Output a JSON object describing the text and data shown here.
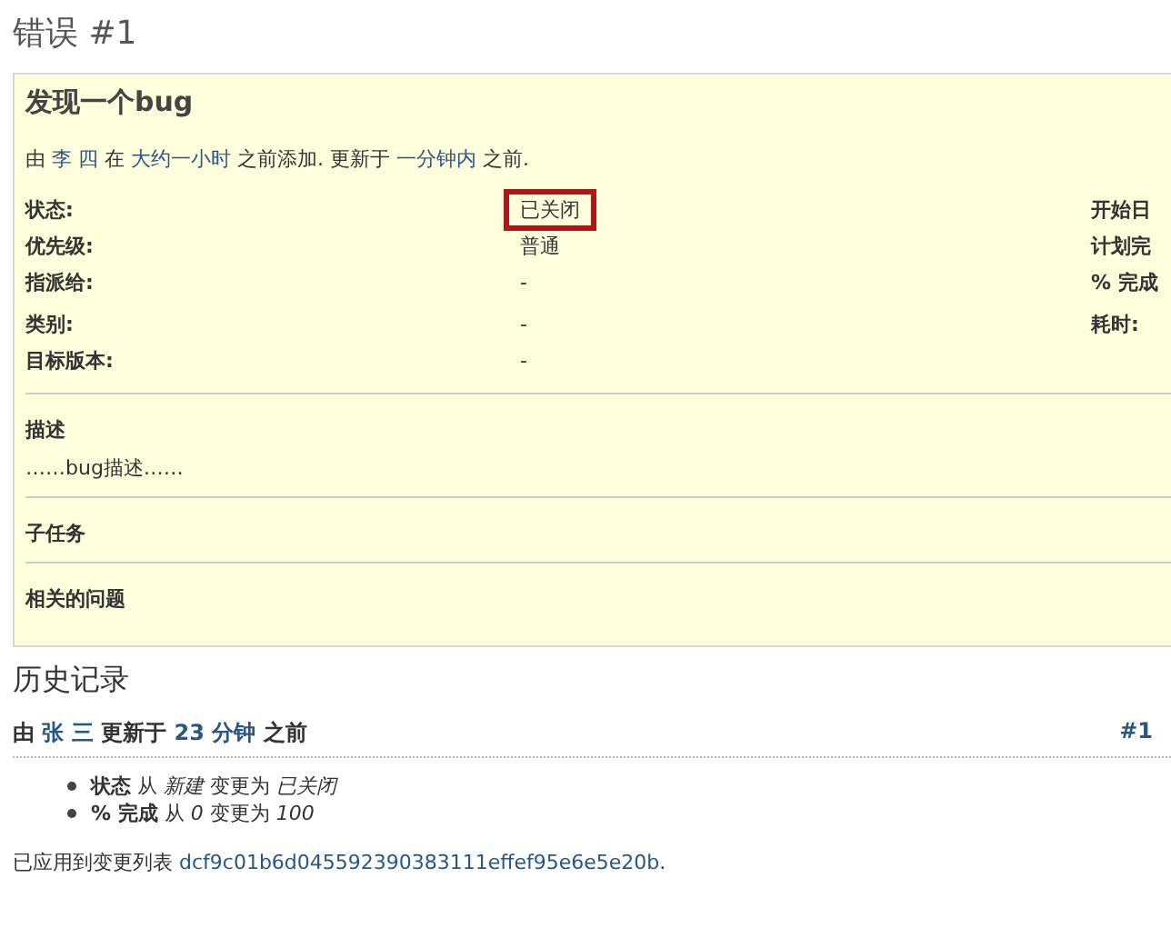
{
  "page_title": "错误 #1",
  "issue": {
    "subject": "发现一个bug",
    "meta": {
      "by": "由 ",
      "author": "李 四",
      "at": " 在 ",
      "age": "大约一小时",
      "added": " 之前添加. 更新于 ",
      "updated": "一分钟内",
      "end": " 之前."
    },
    "attributes": [
      {
        "label": "状态:",
        "value": "已关闭",
        "highlighted": true,
        "right_label": "开始日"
      },
      {
        "label": "优先级:",
        "value": "普通",
        "highlighted": false,
        "right_label": "计划完"
      },
      {
        "label": "指派给:",
        "value": "-",
        "highlighted": false,
        "right_label": "% 完成"
      },
      {
        "label": "类别:",
        "value": "-",
        "highlighted": false,
        "right_label": "耗时:"
      },
      {
        "label": "目标版本:",
        "value": "-",
        "highlighted": false
      }
    ],
    "description_heading": "描述",
    "description": "……bug描述……",
    "subtasks_heading": "子任务",
    "relations_heading": "相关的问题"
  },
  "history": {
    "heading": "历史记录",
    "journal": {
      "header": {
        "by": "由 ",
        "author": "张 三",
        "updated": " 更新于 ",
        "age": "23 分钟",
        "end": " 之前"
      },
      "number": "#1",
      "details": [
        "**状态** 从 *新建* 变更为 *已关闭*",
        "**% 完成** 从 *0* 变更为 *100*"
      ]
    },
    "changeset_text": "已应用到变更列表",
    "changeset_link": "dcf9c01b6d045592390383111effef95e6e5e20b",
    "changeset_end": "."
  }
}
